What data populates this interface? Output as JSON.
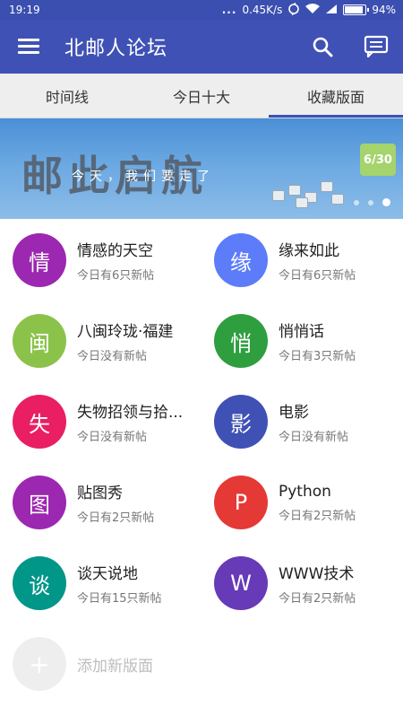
{
  "status": {
    "time": "19:19",
    "dots": "...",
    "speed": "0.45K/s",
    "battery": "94%"
  },
  "appbar": {
    "title": "北邮人论坛",
    "icons": [
      "menu-icon",
      "search-icon",
      "message-icon"
    ]
  },
  "tabs": [
    {
      "label": "时间线",
      "active": false
    },
    {
      "label": "今日十大",
      "active": false
    },
    {
      "label": "收藏版面",
      "active": true
    }
  ],
  "banner": {
    "title": "邮此启航",
    "subtitle": "今天，我们要走了",
    "badge": "6/30"
  },
  "boards": [
    {
      "char": "情",
      "name": "情感的天空",
      "sub": "今日有6只新帖",
      "color": "#9c27b0"
    },
    {
      "char": "缘",
      "name": "缘来如此",
      "sub": "今日有6只新帖",
      "color": "#5c7cfa"
    },
    {
      "char": "闽",
      "name": "八闽玲珑·福建",
      "sub": "今日没有新帖",
      "color": "#8bc34a"
    },
    {
      "char": "悄",
      "name": "悄悄话",
      "sub": "今日有3只新帖",
      "color": "#2e9e3e"
    },
    {
      "char": "失",
      "name": "失物招领与拾...",
      "sub": "今日没有新帖",
      "color": "#e91e63"
    },
    {
      "char": "影",
      "name": "电影",
      "sub": "今日没有新帖",
      "color": "#3f51b5"
    },
    {
      "char": "图",
      "name": "贴图秀",
      "sub": "今日有2只新帖",
      "color": "#9c27b0"
    },
    {
      "char": "P",
      "name": "Python",
      "sub": "今日有2只新帖",
      "color": "#e53935"
    },
    {
      "char": "谈",
      "name": "谈天说地",
      "sub": "今日有15只新帖",
      "color": "#009688"
    },
    {
      "char": "W",
      "name": "WWW技术",
      "sub": "今日有2只新帖",
      "color": "#673ab7"
    }
  ],
  "add_board": {
    "char": "+",
    "label": "添加新版面"
  }
}
